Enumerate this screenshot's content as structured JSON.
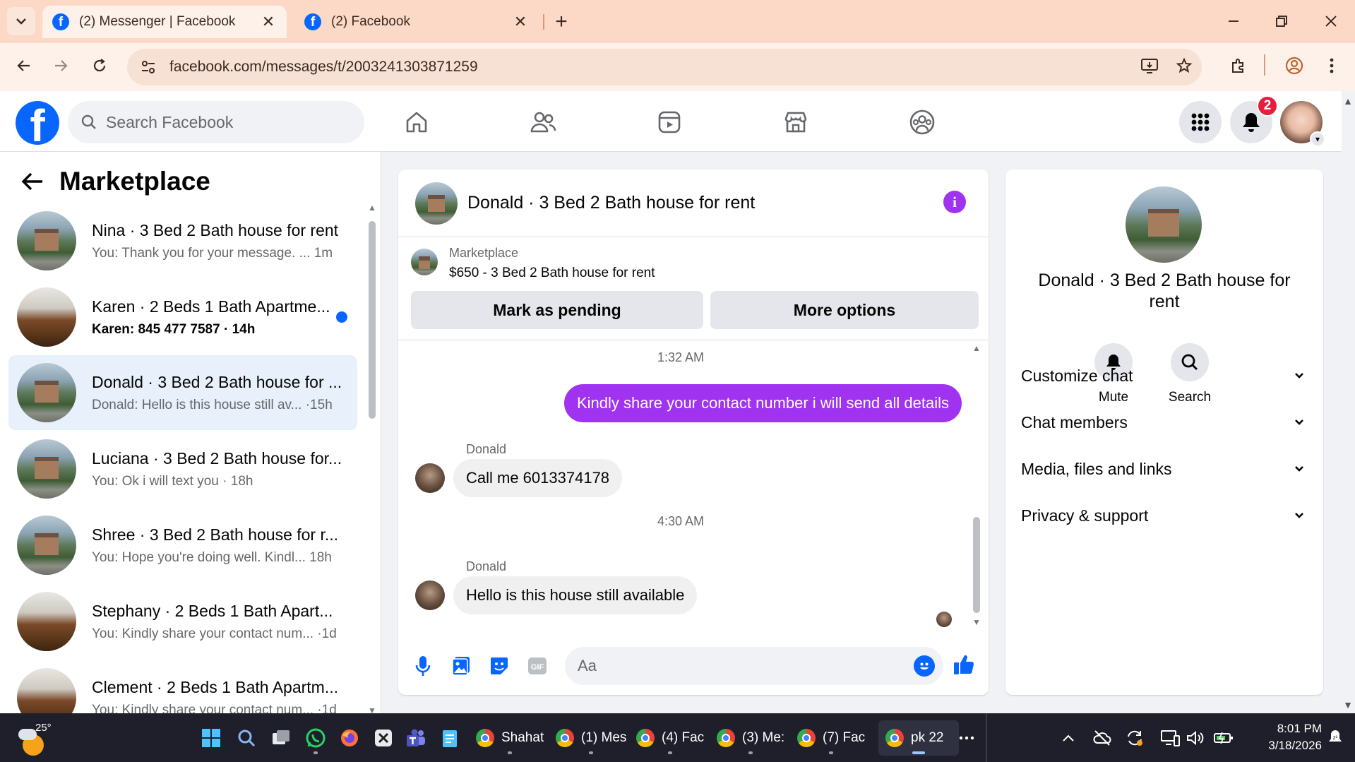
{
  "browser": {
    "tabs": [
      {
        "title": "(2) Messenger | Facebook",
        "active": true
      },
      {
        "title": "(2) Facebook",
        "active": false
      }
    ],
    "url": "facebook.com/messages/t/2003241303871259"
  },
  "fb": {
    "search_placeholder": "Search Facebook",
    "notifications_badge": "2",
    "brand_color": "#0866ff",
    "accent_color": "#a033f0"
  },
  "left": {
    "title": "Marketplace",
    "conversations": [
      {
        "name": "Nina · 3 Bed 2 Bath house for rent",
        "preview": "You: Thank you for your message. ...  1m",
        "thumb": "house",
        "unread": false,
        "selected": false
      },
      {
        "name": "Karen · 2 Beds 1 Bath Apartme...",
        "preview": "Karen: 845 477 7587 · 14h",
        "thumb": "kitchen",
        "unread": true,
        "selected": false
      },
      {
        "name": "Donald · 3 Bed 2 Bath house for ...",
        "preview": "Donald: Hello is this house still av... ·15h",
        "thumb": "house",
        "unread": false,
        "selected": true
      },
      {
        "name": "Luciana · 3 Bed 2 Bath house for...",
        "preview": "You: Ok i will text you · 18h",
        "thumb": "house",
        "unread": false,
        "selected": false
      },
      {
        "name": "Shree · 3 Bed 2 Bath house for r...",
        "preview": "You: Hope you're doing well. Kindl...  18h",
        "thumb": "house",
        "unread": false,
        "selected": false
      },
      {
        "name": "Stephany · 2 Beds 1 Bath Apart...",
        "preview": "You: Kindly share your contact num... ·1d",
        "thumb": "kitchen",
        "unread": false,
        "selected": false
      },
      {
        "name": "Clement · 2 Beds 1 Bath Apartm...",
        "preview": "You: Kindly share your contact num... ·1d",
        "thumb": "kitchen",
        "unread": false,
        "selected": false
      }
    ]
  },
  "chat": {
    "title": "Donald · 3 Bed 2 Bath house for rent",
    "marketplace_label": "Marketplace",
    "listing": "$650 - 3 Bed 2 Bath house for rent",
    "mark_pending": "Mark as pending",
    "more_options": "More options",
    "time1": "1:32 AM",
    "outgoing": "Kindly share your contact number i will send all details",
    "sender1": "Donald",
    "incoming1": "Call me 6013374178",
    "time2": "4:30 AM",
    "sender2": "Donald",
    "incoming2": "Hello is this house still available",
    "input_placeholder": "Aa"
  },
  "right": {
    "name": "Donald · 3 Bed 2 Bath house for rent",
    "mute": "Mute",
    "search": "Search",
    "sections": [
      "Customize chat",
      "Chat members",
      "Media, files and links",
      "Privacy & support"
    ]
  },
  "taskbar": {
    "temperature": "25°",
    "apps": [
      "Shahat",
      "(1) Mes",
      "(4) Fac",
      "(3) Me:",
      "(7) Fac",
      "pk 22"
    ],
    "time": "8:01 PM",
    "date": "3/18/2026"
  }
}
